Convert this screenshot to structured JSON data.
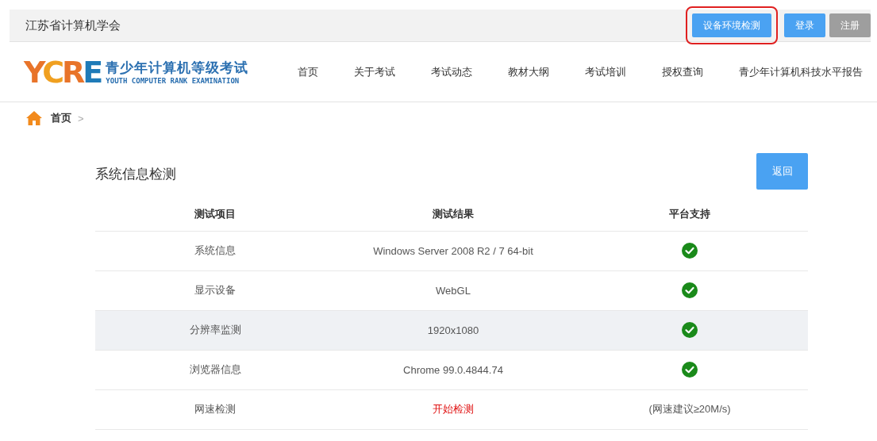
{
  "top_bar": {
    "org": "江苏省计算机学会",
    "buttons": [
      {
        "label": "设备环境检测",
        "kind": "primary",
        "highlighted": true
      },
      {
        "label": "登录",
        "kind": "primary",
        "highlighted": false
      },
      {
        "label": "注册",
        "kind": "grey",
        "highlighted": false
      }
    ]
  },
  "header": {
    "logo": {
      "letters": [
        {
          "text": "Y",
          "color": "#e8742a"
        },
        {
          "text": "C",
          "color": "#f0a020"
        },
        {
          "text": "R",
          "color": "#e8742a"
        },
        {
          "text": "E",
          "color": "#1f7bb8"
        }
      ],
      "title": "青少年计算机等级考试",
      "subtitle": "YOUTH COMPUTER RANK EXAMINATION"
    },
    "nav": [
      "首页",
      "关于考试",
      "考试动态",
      "教材大纲",
      "考试培训",
      "授权查询",
      "青少年计算机科技水平报告"
    ]
  },
  "breadcrumb": {
    "items": [
      "首页"
    ],
    "separator": ">"
  },
  "panel": {
    "title": "系统信息检测",
    "back_button": "返回",
    "table": {
      "columns": [
        "测试项目",
        "测试结果",
        "平台支持"
      ],
      "rows": [
        {
          "item": "系统信息",
          "result": {
            "kind": "text",
            "text": "Windows Server 2008 R2 / 7 64-bit"
          },
          "support": {
            "kind": "check"
          },
          "highlighted": false
        },
        {
          "item": "显示设备",
          "result": {
            "kind": "text",
            "text": "WebGL"
          },
          "support": {
            "kind": "check"
          },
          "highlighted": false
        },
        {
          "item": "分辨率监测",
          "result": {
            "kind": "text",
            "text": "1920x1080"
          },
          "support": {
            "kind": "check"
          },
          "highlighted": true
        },
        {
          "item": "浏览器信息",
          "result": {
            "kind": "text",
            "text": "Chrome 99.0.4844.74"
          },
          "support": {
            "kind": "check"
          },
          "highlighted": false
        },
        {
          "item": "网速检测",
          "result": {
            "kind": "link",
            "text": "开始检测"
          },
          "support": {
            "kind": "text",
            "text": "(网速建议≥20M/s)"
          },
          "highlighted": false
        }
      ]
    }
  }
}
